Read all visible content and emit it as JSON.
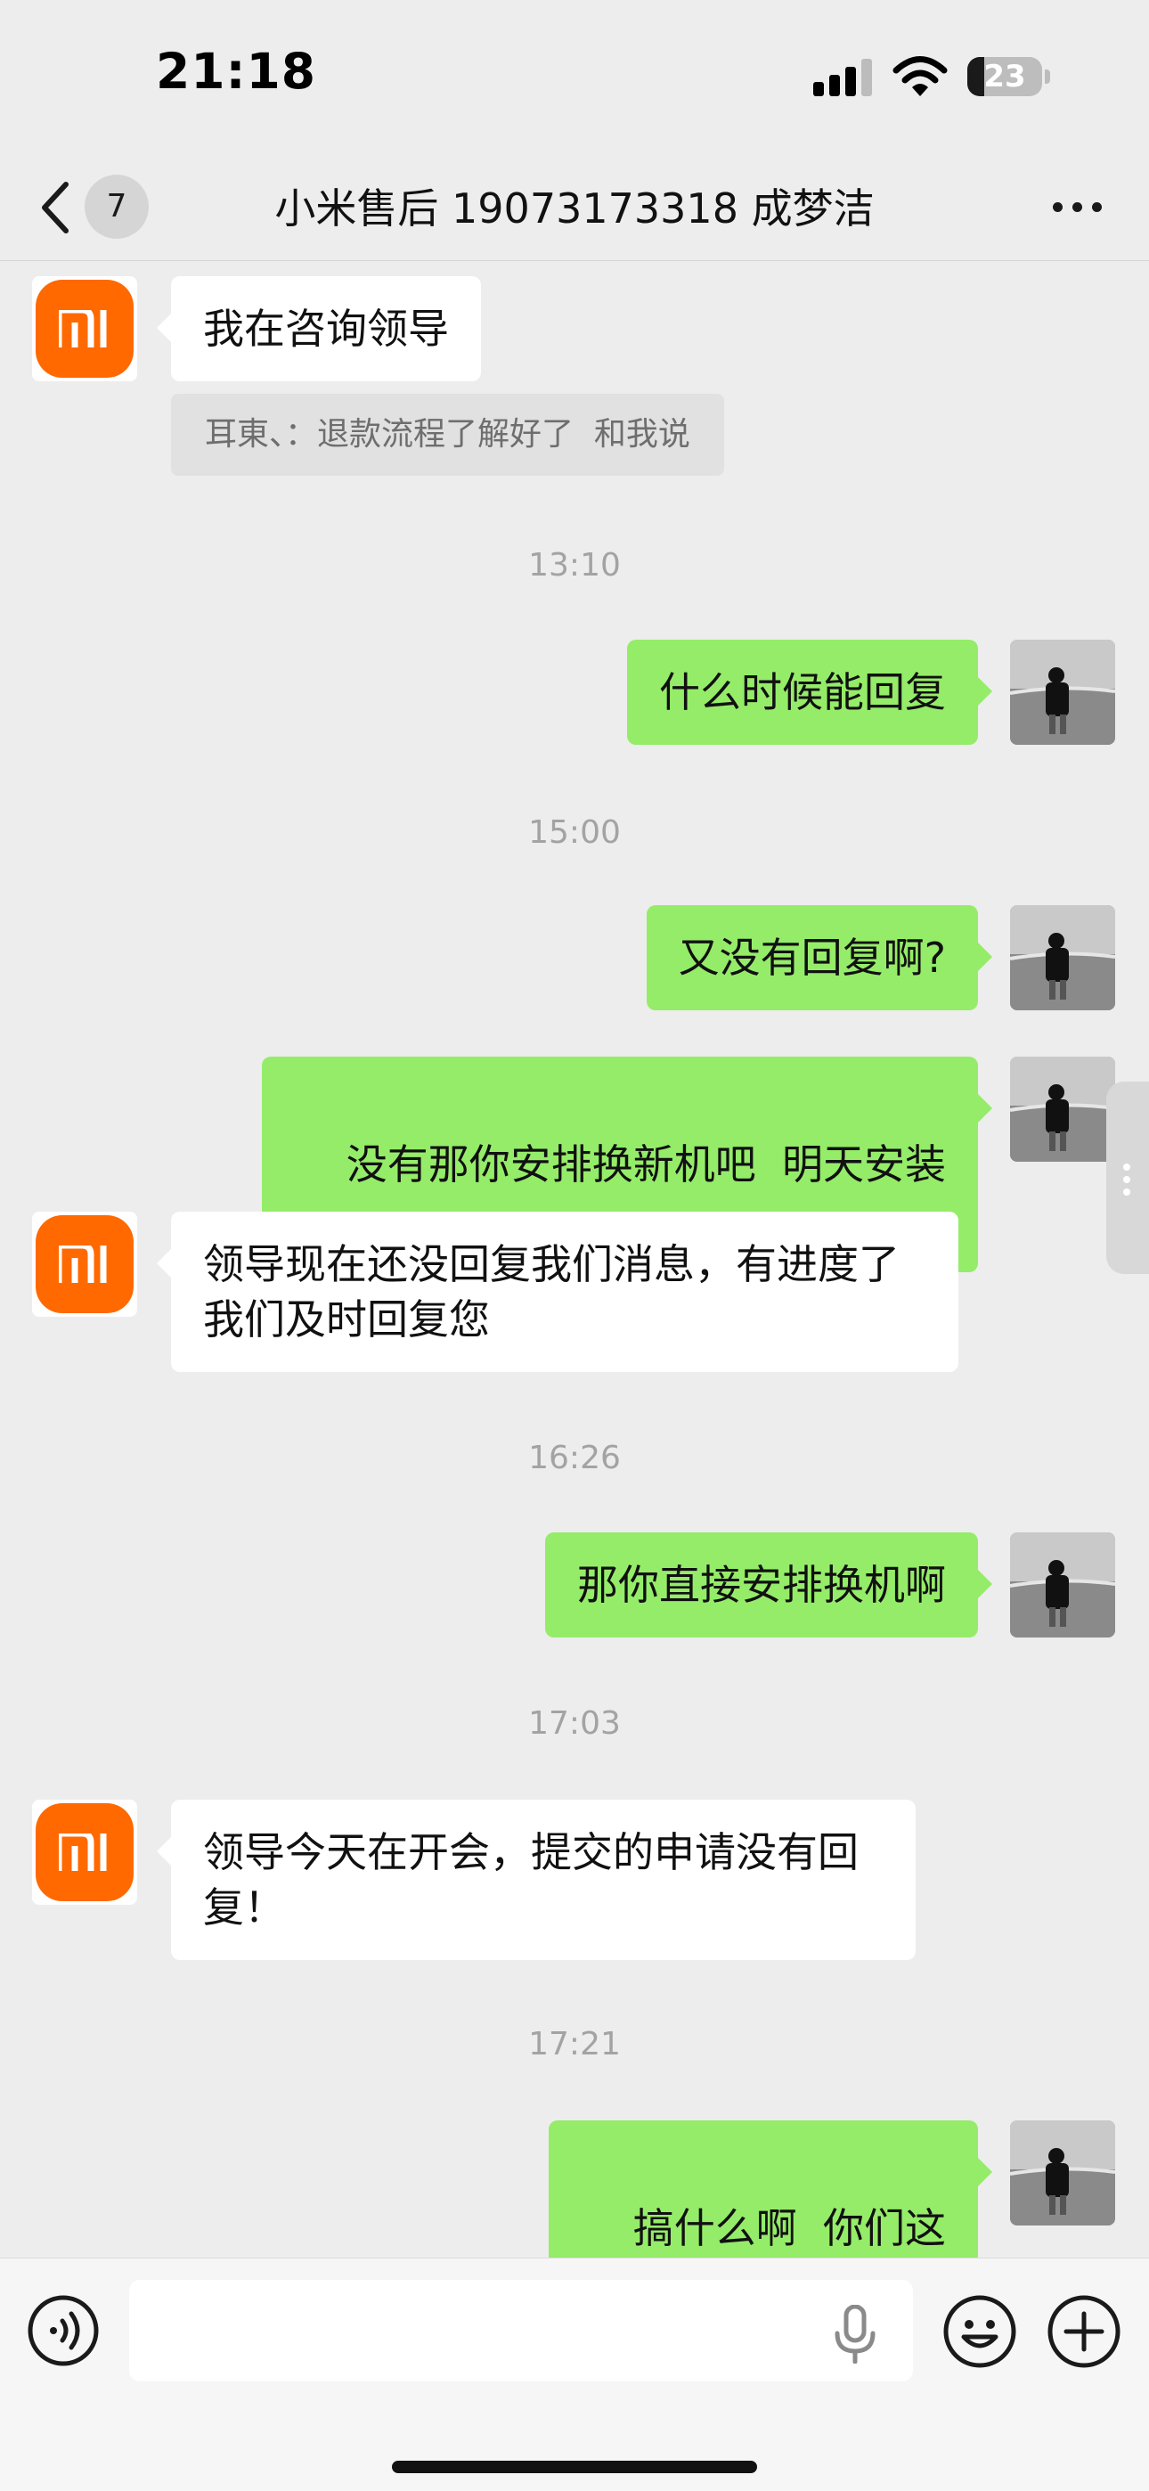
{
  "status_bar": {
    "time": "21:18",
    "battery_level": "23",
    "battery_fraction": 0.23,
    "icons": [
      "signal-icon",
      "wifi-icon",
      "battery-icon"
    ]
  },
  "nav": {
    "unread_count": "7",
    "title": "小米售后 19073173318 成梦洁",
    "icons": [
      "back-icon",
      "more-icon"
    ]
  },
  "messages": {
    "m1": {
      "sender": "other",
      "text": "我在咨询领导"
    },
    "m1_quote": {
      "text": "耳東、：退款流程了解好了  和我说"
    },
    "t1": "13:10",
    "m2": {
      "sender": "me",
      "text": "什么时候能回复"
    },
    "t2": "15:00",
    "m3": {
      "sender": "me",
      "text": "又没有回复啊?"
    },
    "m4": {
      "sender": "me",
      "text": "没有那你安排换新机吧  明天安装"
    },
    "m5": {
      "sender": "other",
      "line1": "领导现在还没回复我们消息，有进度了",
      "line2": "我们及时回复您"
    },
    "t3": "16:26",
    "m6": {
      "sender": "me",
      "text": "那你直接安排换机啊"
    },
    "t4": "17:03",
    "m7": {
      "sender": "other",
      "line1": "领导今天在开会，提交的申请没有回",
      "line2": "复！"
    },
    "t5": "17:21",
    "m8": {
      "sender": "me",
      "text": "搞什么啊  你们这"
    }
  },
  "input_bar": {
    "placeholder": "",
    "icons": [
      "voice-icon",
      "mic-icon",
      "emoji-icon",
      "plus-icon"
    ]
  },
  "colors": {
    "background": "#ededed",
    "outgoing_bubble": "#95ec69",
    "incoming_bubble": "#ffffff",
    "mi_brand": "#ff6900"
  }
}
